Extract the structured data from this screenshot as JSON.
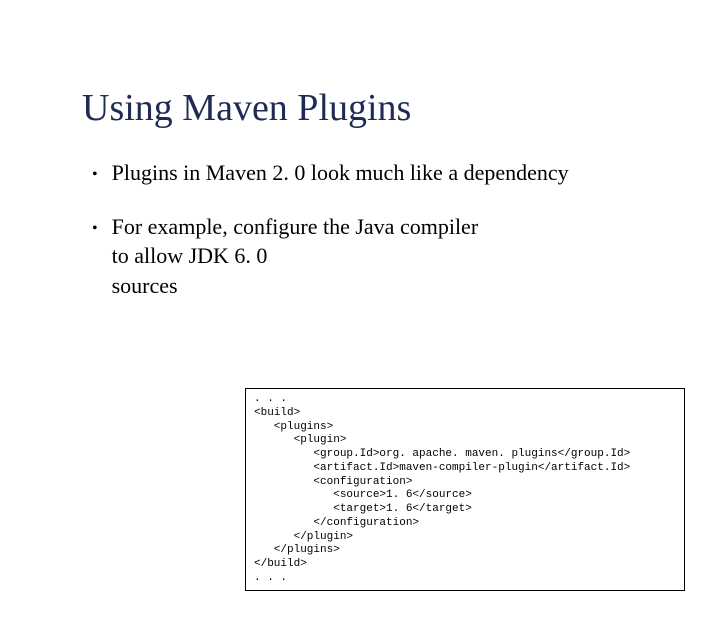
{
  "title": "Using Maven Plugins",
  "bullets": {
    "b1": "Plugins in Maven 2. 0 look much like a dependency",
    "b2_line1": "For example, configure the Java compiler",
    "b2_rest": "to allow JDK 6. 0 sources"
  },
  "code": ". . .\n<build>\n   <plugins>\n      <plugin>\n         <group.Id>org. apache. maven. plugins</group.Id>\n         <artifact.Id>maven-compiler-plugin</artifact.Id>\n         <configuration>\n            <source>1. 6</source>\n            <target>1. 6</target>\n         </configuration>\n      </plugin>\n   </plugins>\n</build>\n. . ."
}
